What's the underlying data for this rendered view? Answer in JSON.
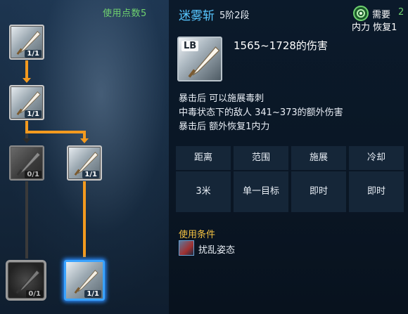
{
  "tree": {
    "points_label": "使用点数5",
    "nodes": [
      {
        "id": "node-1",
        "level": "1/1",
        "state": "learned"
      },
      {
        "id": "node-2",
        "level": "1/1",
        "state": "learned"
      },
      {
        "id": "node-3",
        "level": "0/1",
        "state": "locked"
      },
      {
        "id": "node-4",
        "level": "1/1",
        "state": "learned"
      },
      {
        "id": "node-5",
        "level": "0/1",
        "state": "locked"
      },
      {
        "id": "node-6",
        "level": "1/1",
        "state": "selected"
      }
    ]
  },
  "skill": {
    "name": "迷雾斩",
    "rank": "5阶2段",
    "key": "LB",
    "damage": "1565~1728的伤害",
    "effects": [
      "暴击后 可以施展毒刺",
      "中毒状态下的敌人 341~373的额外伤害",
      "暴击后 额外恢复1内力"
    ]
  },
  "requirement": {
    "label": "需要",
    "value": "2",
    "sub": "内力 恢复1"
  },
  "stats": {
    "headers": [
      "距离",
      "范围",
      "施展",
      "冷却"
    ],
    "values": [
      "3米",
      "单一目标",
      "即时",
      "即时"
    ]
  },
  "conditions": {
    "label": "使用条件",
    "items": [
      "扰乱姿态"
    ]
  },
  "colors": {
    "accent": "#57c6ff",
    "connector": "#f39a1f",
    "condition_label": "#f3c141",
    "requirement_value": "#6fd16f"
  }
}
